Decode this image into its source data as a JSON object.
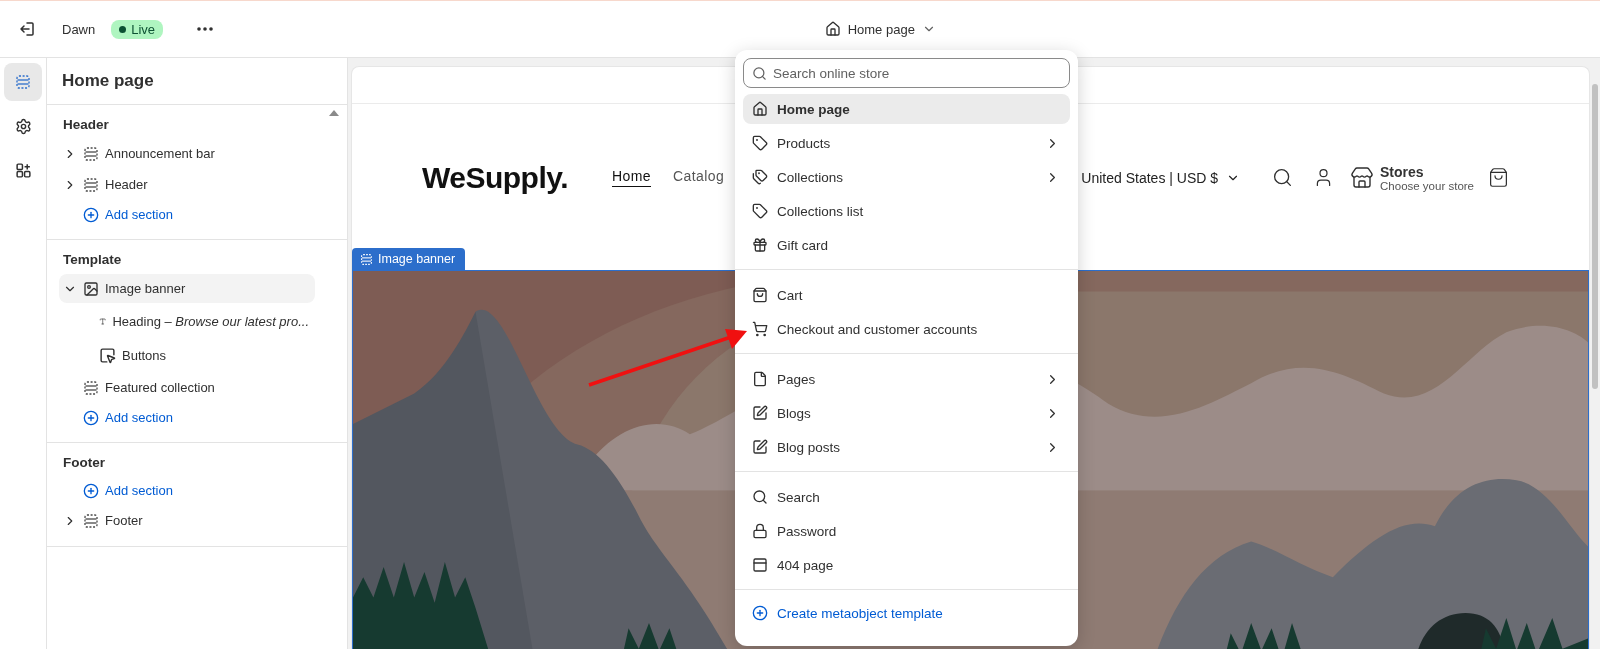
{
  "topbar": {
    "theme_name": "Dawn",
    "status": "Live",
    "page_selector": "Home page"
  },
  "rail": [
    {
      "kind": "sections",
      "selected": true
    },
    {
      "kind": "settings",
      "selected": false
    },
    {
      "kind": "apps",
      "selected": false
    }
  ],
  "sidebar": {
    "title": "Home page",
    "groups": [
      {
        "title": "Header",
        "items": [
          {
            "kind": "section",
            "label": "Announcement bar",
            "expanded": false,
            "selected": false
          },
          {
            "kind": "section",
            "label": "Header",
            "expanded": false,
            "selected": false
          },
          {
            "kind": "add",
            "label": "Add section"
          }
        ]
      },
      {
        "title": "Template",
        "items": [
          {
            "kind": "image",
            "label": "Image banner",
            "expanded": true,
            "selected": true,
            "children": [
              {
                "kind": "text",
                "label": "Heading – *Browse our latest pro...*",
                "selected": false
              },
              {
                "kind": "button",
                "label": "Buttons",
                "selected": false
              }
            ]
          },
          {
            "kind": "section",
            "label": "Featured collection",
            "selected": false
          },
          {
            "kind": "add",
            "label": "Add section"
          }
        ]
      },
      {
        "title": "Footer",
        "items": [
          {
            "kind": "add",
            "label": "Add section"
          },
          {
            "kind": "section",
            "label": "Footer",
            "expanded": false,
            "selected": false
          }
        ]
      }
    ]
  },
  "preview": {
    "logo": "WeSupply.",
    "nav": [
      {
        "label": "Home",
        "selected": true
      },
      {
        "label": "Catalog",
        "selected": false
      }
    ],
    "locale": "United States | USD $",
    "stores_title": "Stores",
    "stores_subtitle": "Choose your store",
    "section_tag": "Image banner"
  },
  "page_menu": {
    "search": {
      "placeholder": "Search online store"
    },
    "groups": [
      [
        {
          "kind": "home",
          "label": "Home page",
          "selected": true,
          "submenu": false
        },
        {
          "kind": "product",
          "label": "Products",
          "selected": false,
          "submenu": true
        },
        {
          "kind": "collection",
          "label": "Collections",
          "selected": false,
          "submenu": true
        },
        {
          "kind": "collection_list",
          "label": "Collections list",
          "selected": false,
          "submenu": false
        },
        {
          "kind": "gift",
          "label": "Gift card",
          "selected": false,
          "submenu": false
        }
      ],
      [
        {
          "kind": "cart",
          "label": "Cart",
          "selected": false,
          "submenu": false
        },
        {
          "kind": "checkout",
          "label": "Checkout and customer accounts",
          "selected": false,
          "submenu": false
        }
      ],
      [
        {
          "kind": "page",
          "label": "Pages",
          "selected": false,
          "submenu": true
        },
        {
          "kind": "blog",
          "label": "Blogs",
          "selected": false,
          "submenu": true
        },
        {
          "kind": "blog",
          "label": "Blog posts",
          "selected": false,
          "submenu": true
        }
      ],
      [
        {
          "kind": "search",
          "label": "Search",
          "selected": false,
          "submenu": false
        },
        {
          "kind": "password",
          "label": "Password",
          "selected": false,
          "submenu": false
        },
        {
          "kind": "not_found",
          "label": "404 page",
          "selected": false,
          "submenu": false
        }
      ]
    ],
    "action": "Create metaobject template"
  }
}
